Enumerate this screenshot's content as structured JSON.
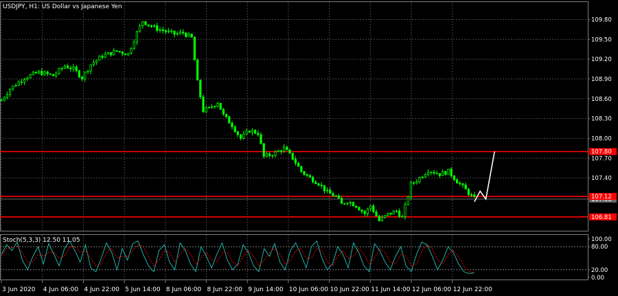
{
  "window": {
    "title": "USDJPY, H1:  US Dollar vs Japanese Yen"
  },
  "colors": {
    "background": "#000000",
    "grid": "#4a4a4a",
    "candles": "#00ff00",
    "level_line": "#ff0000",
    "forecast_line": "#ffffff",
    "bid_line": "#6b6b6b",
    "stoch_main": "#20b2aa",
    "stoch_signal": "#ff0000",
    "axis_text": "#ffffff"
  },
  "chart_data": [
    {
      "type": "line",
      "subtype": "candlestick",
      "title": "USDJPY, H1:  US Dollar vs Japanese Yen",
      "price_axis_labels": [
        "109.80",
        "109.50",
        "109.20",
        "108.90",
        "108.60",
        "108.30",
        "108.00",
        "107.70",
        "107.40",
        "107.08"
      ],
      "ylim": [
        106.6,
        109.95
      ],
      "grid": true,
      "time_axis_labels": [
        "3 Jun 2020",
        "4 Jun 06:00",
        "4 Jun 22:00",
        "5 Jun 14:00",
        "8 Jun 06:00",
        "8 Jun 22:00",
        "9 Jun 14:00",
        "10 Jun 06:00",
        "10 Jun 22:00",
        "11 Jun 14:00",
        "12 Jun 06:00",
        "12 Jun 22:00"
      ],
      "price_path": [
        [
          0,
          108.58
        ],
        [
          3,
          108.75
        ],
        [
          8,
          108.92
        ],
        [
          13,
          109.0
        ],
        [
          18,
          108.95
        ],
        [
          22,
          109.1
        ],
        [
          25,
          109.05
        ],
        [
          28,
          108.92
        ],
        [
          31,
          109.12
        ],
        [
          35,
          109.25
        ],
        [
          40,
          109.32
        ],
        [
          44,
          109.28
        ],
        [
          47,
          109.6
        ],
        [
          49,
          109.78
        ],
        [
          51,
          109.72
        ],
        [
          54,
          109.66
        ],
        [
          57,
          109.62
        ],
        [
          60,
          109.58
        ],
        [
          63,
          109.6
        ],
        [
          66,
          109.52
        ],
        [
          68,
          108.85
        ],
        [
          70,
          108.42
        ],
        [
          72,
          108.45
        ],
        [
          75,
          108.55
        ],
        [
          77,
          108.35
        ],
        [
          80,
          108.2
        ],
        [
          83,
          108.0
        ],
        [
          86,
          108.12
        ],
        [
          89,
          108.08
        ],
        [
          91,
          107.72
        ],
        [
          95,
          107.78
        ],
        [
          98,
          107.85
        ],
        [
          101,
          107.7
        ],
        [
          104,
          107.5
        ],
        [
          107,
          107.4
        ],
        [
          110,
          107.32
        ],
        [
          113,
          107.18
        ],
        [
          116,
          107.12
        ],
        [
          118,
          107.0
        ],
        [
          120,
          107.05
        ],
        [
          123,
          106.98
        ],
        [
          126,
          106.86
        ],
        [
          128,
          106.98
        ],
        [
          131,
          106.75
        ],
        [
          134,
          106.85
        ],
        [
          137,
          106.9
        ],
        [
          139,
          106.8
        ],
        [
          142,
          107.3
        ],
        [
          145,
          107.4
        ],
        [
          148,
          107.52
        ],
        [
          152,
          107.46
        ],
        [
          155,
          107.5
        ],
        [
          158,
          107.35
        ],
        [
          161,
          107.22
        ],
        [
          164,
          107.08
        ]
      ],
      "forecast_path": [
        [
          164,
          107.04
        ],
        [
          166,
          107.2
        ],
        [
          168,
          107.08
        ],
        [
          171,
          107.8
        ]
      ],
      "horizontal_levels": [
        {
          "name": "resistance",
          "label": "107.80",
          "value": 107.8
        },
        {
          "name": "pivot",
          "label": "107.12",
          "value": 107.12
        },
        {
          "name": "support",
          "label": "106.81",
          "value": 106.81
        }
      ],
      "current_bid": {
        "label": "107.08",
        "value": 107.08
      }
    },
    {
      "type": "line",
      "title": "Stoch(5,3,3) 12.50 11.05",
      "axis_labels": [
        "100.00",
        "80.00",
        "20.00",
        "0.00"
      ],
      "ylim": [
        0,
        100
      ],
      "levels": [
        80,
        20
      ],
      "series": [
        {
          "name": "main",
          "values": [
            60,
            85,
            70,
            92,
            45,
            20,
            55,
            80,
            35,
            88,
            60,
            30,
            75,
            95,
            70,
            40,
            85,
            25,
            15,
            50,
            90,
            65,
            20,
            75,
            45,
            88,
            95,
            60,
            30,
            15,
            70,
            85,
            40,
            20,
            90,
            70,
            35,
            15,
            80,
            55,
            25,
            60,
            90,
            45,
            20,
            35,
            85,
            65,
            30,
            15,
            75,
            55,
            88,
            40,
            20,
            70,
            90,
            60,
            25,
            80,
            95,
            50,
            20,
            35,
            80,
            60,
            25,
            90,
            65,
            30,
            15,
            88,
            70,
            40,
            20,
            55,
            80,
            30,
            15,
            60,
            92,
            85,
            55,
            20,
            45,
            80,
            65,
            35,
            15,
            10,
            12
          ]
        },
        {
          "name": "signal",
          "values": [
            55,
            75,
            78,
            82,
            65,
            40,
            40,
            60,
            55,
            65,
            65,
            50,
            55,
            80,
            80,
            65,
            70,
            50,
            30,
            35,
            65,
            75,
            50,
            55,
            55,
            70,
            85,
            80,
            55,
            30,
            45,
            70,
            65,
            40,
            60,
            75,
            60,
            35,
            50,
            65,
            45,
            40,
            65,
            65,
            40,
            30,
            55,
            70,
            55,
            30,
            45,
            65,
            75,
            60,
            35,
            45,
            70,
            75,
            50,
            50,
            75,
            70,
            40,
            30,
            55,
            70,
            50,
            55,
            75,
            60,
            35,
            50,
            75,
            65,
            40,
            35,
            60,
            55,
            30,
            35,
            70,
            85,
            75,
            45,
            35,
            60,
            70,
            55,
            30,
            15,
            11
          ]
        }
      ]
    }
  ]
}
